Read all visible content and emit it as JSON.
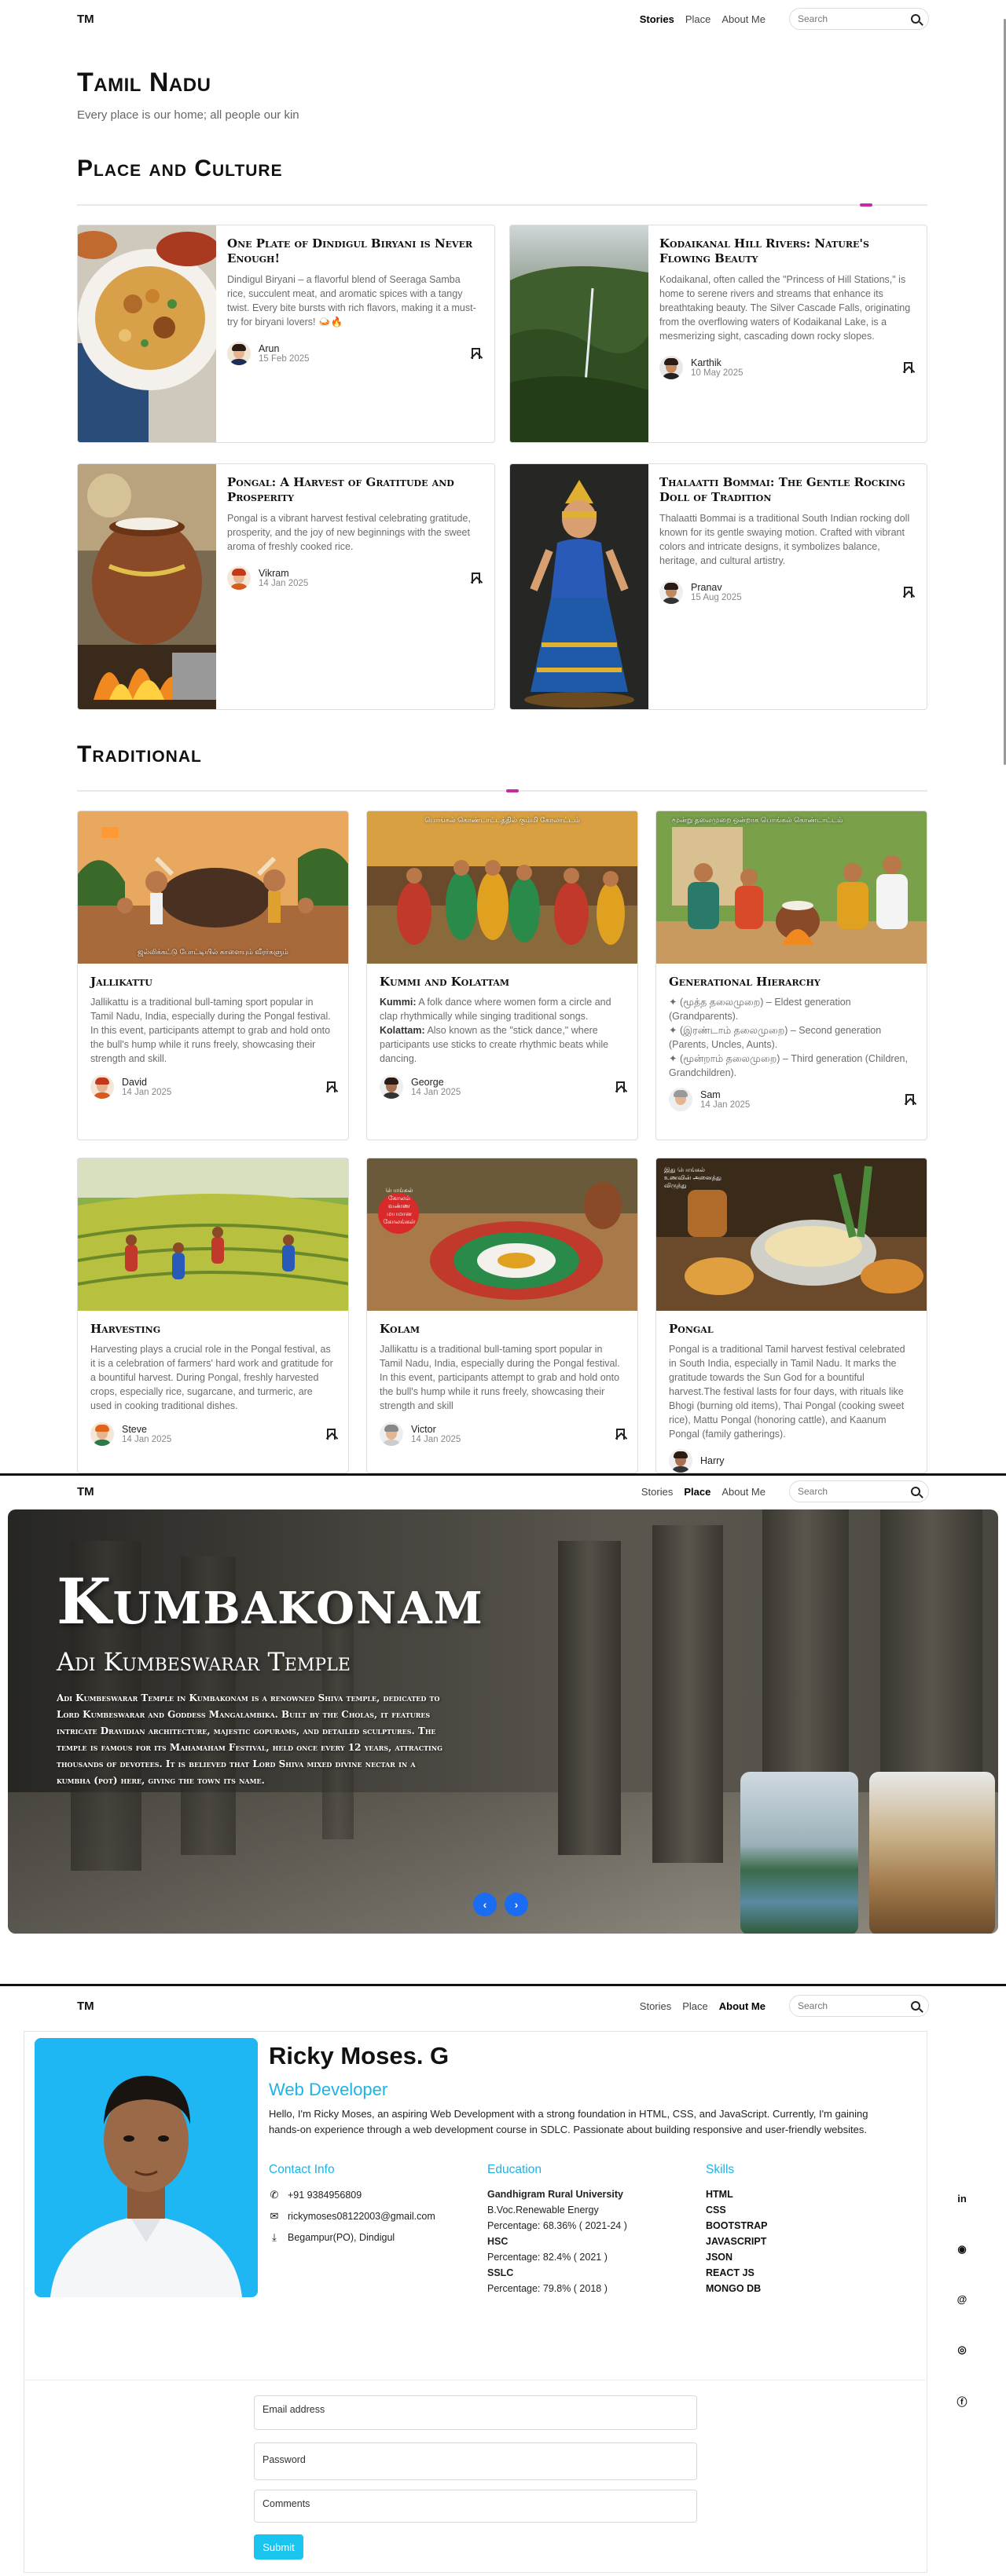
{
  "nav": {
    "brand": "TM",
    "links": [
      "Stories",
      "Place",
      "About Me"
    ],
    "search_placeholder": "Search"
  },
  "stories": {
    "title": "Tamil Nadu",
    "subtitle": "Every place is our home; all people our kin",
    "place_culture": {
      "heading": "Place and Culture",
      "cards": [
        {
          "title": "One Plate of Dindigul Biryani is Never Enough!",
          "text": "Dindigul Biryani – a flavorful blend of Seeraga Samba rice, succulent meat, and aromatic spices with a tangy twist. Every bite bursts with rich flavors, making it a must-try for biryani lovers! 🍛🔥",
          "author": "Arun",
          "date": "15 Feb 2025"
        },
        {
          "title": "Kodaikanal Hill Rivers: Nature's Flowing Beauty",
          "text": "Kodaikanal, often called the \"Princess of Hill Stations,\" is home to serene rivers and streams that enhance its breathtaking beauty. The Silver Cascade Falls, originating from the overflowing waters of Kodaikanal Lake, is a mesmerizing sight, cascading down rocky slopes.",
          "author": "Karthik",
          "date": "10 May 2025"
        },
        {
          "title": "Pongal: A Harvest of Gratitude and Prosperity",
          "text": "Pongal is a vibrant harvest festival celebrating gratitude, prosperity, and the joy of new beginnings with the sweet aroma of freshly cooked rice.",
          "author": "Vikram",
          "date": "14 Jan 2025"
        },
        {
          "title": "Thalaatti Bommai: The Gentle Rocking Doll of Tradition",
          "text": "Thalaatti Bommai is a traditional South Indian rocking doll known for its gentle swaying motion. Crafted with vibrant colors and intricate designs, it symbolizes balance, heritage, and cultural artistry.",
          "author": "Pranav",
          "date": "15 Aug 2025"
        }
      ]
    },
    "traditional": {
      "heading": "Traditional",
      "cards": [
        {
          "title": "Jallikattu",
          "text": "Jallikattu is a traditional bull-taming sport popular in Tamil Nadu, India, especially during the Pongal festival. In this event, participants attempt to grab and hold onto the bull's hump while it runs freely, showcasing their strength and skill.",
          "author": "David",
          "date": "14 Jan 2025",
          "img_caption": "ஜல்லிக்கட்டு போட்டியில் காளையும் வீரர்களும்"
        },
        {
          "title": "Kummi and Kolattam",
          "kummi_label": "Kummi:",
          "kummi_text": " A folk dance where women form a circle and clap rhythmically while singing traditional songs.",
          "kolattam_label": "Kolattam:",
          "kolattam_text": " Also known as the \"stick dance,\" where participants use sticks to create rhythmic beats while dancing.",
          "author": "George",
          "date": "14 Jan 2025",
          "img_caption": "பொங்கல் கொண்டாட்டத்தில் கும்மி கோலாட்டம்"
        },
        {
          "title": "Generational Hierarchy",
          "lines": [
            "✦ (மூத்த தலைமுறை) – Eldest generation (Grandparents).",
            "✦ (இரண்டாம் தலைமுறை) – Second generation (Parents, Uncles, Aunts).",
            "✦ (மூன்றாம் தலைமுறை) – Third generation (Children, Grandchildren)."
          ],
          "author": "Sam",
          "date": "14 Jan 2025",
          "img_caption": "மூன்று தலைமுறை ஒன்றாக பொங்கல் கொண்டாட்டம்"
        },
        {
          "title": "Harvesting",
          "text": "Harvesting plays a crucial role in the Pongal festival, as it is a celebration of farmers' hard work and gratitude for a bountiful harvest. During Pongal, freshly harvested crops, especially rice, sugarcane, and turmeric, are used in cooking traditional dishes.",
          "author": "Steve",
          "date": "14 Jan 2025"
        },
        {
          "title": "Kolam",
          "text": "Jallikattu is a traditional bull-taming sport popular in Tamil Nadu, India, especially during the Pongal festival. In this event, participants attempt to grab and hold onto the bull's hump while it runs freely, showcasing their strength and skill",
          "author": "Victor",
          "date": "14 Jan 2025",
          "img_caption": "பொங்கல் கோலம் வண்ண மயமான கோலங்கள்"
        },
        {
          "title": "Pongal",
          "text": "Pongal is a traditional Tamil harvest festival celebrated in South India, especially in Tamil Nadu. It marks the gratitude towards the Sun God for a bountiful harvest.The festival lasts for four days, with rituals like Bhogi (burning old items), Thai Pongal (cooking sweet rice), Mattu Pongal (honoring cattle), and Kaanum Pongal (family gatherings).",
          "author": "Harry",
          "img_caption": "இது பொங்கல் உணவின் அனைத்து விருந்து"
        }
      ]
    }
  },
  "place": {
    "title": "Kumbakonam",
    "subtitle": "Adi Kumbeswarar Temple",
    "description": "Adi Kumbeswarar Temple in Kumbakonam is a renowned Shiva temple, dedicated to Lord Kumbeswarar and Goddess Mangalambika. Built by the Cholas, it features intricate Dravidian architecture, majestic gopurams, and detailed sculptures. The temple is famous for its Mahamaham Festival, held once every 12 years, attracting thousands of devotees. It is believed that Lord Shiva mixed divine nectar in a kumbha (pot) here, giving the town its name.",
    "prev_arrow": "‹",
    "next_arrow": "›"
  },
  "about": {
    "name": "Ricky Moses. G",
    "role": "Web Developer",
    "bio": "Hello, I'm Ricky Moses, an aspiring Web Development with a strong foundation in HTML, CSS, and JavaScript. Currently, I'm gaining hands-on experience through a web development course in SDLC. Passionate about building responsive and user-friendly websites.",
    "contact_heading": "Contact Info",
    "phone": "+91 9384956809",
    "email": "rickymoses08122003@gmail.com",
    "address": "Begampur(PO), Dindigul",
    "education_heading": "Education",
    "education": [
      {
        "text": "Gandhigram Rural University",
        "bold": true
      },
      {
        "text": "B.Voc.Renewable Energy",
        "bold": false
      },
      {
        "text": "Percentage: 68.36% ( 2021-24 )",
        "bold": false
      },
      {
        "text": "HSC",
        "bold": true
      },
      {
        "text": "Percentage: 82.4% ( 2021 )",
        "bold": false
      },
      {
        "text": "SSLC",
        "bold": true
      },
      {
        "text": "Percentage: 79.8% ( 2018 )",
        "bold": false
      }
    ],
    "skills_heading": "Skills",
    "skills": [
      "HTML",
      "CSS",
      "BOOTSTRAP",
      "JAVASCRIPT",
      "JSON",
      "REACT JS",
      "MONGO DB"
    ],
    "social_icons": [
      "in",
      "github-icon",
      "@",
      "instagram-icon",
      "facebook-icon"
    ],
    "form": {
      "email_label": "Email address",
      "password_label": "Password",
      "comments_label": "Comments",
      "submit_label": "Submit"
    }
  },
  "colors": {
    "accent_magenta": "#c82aa4",
    "accent_cyan": "#19b4e8",
    "carousel_blue": "#1a6cf3"
  }
}
